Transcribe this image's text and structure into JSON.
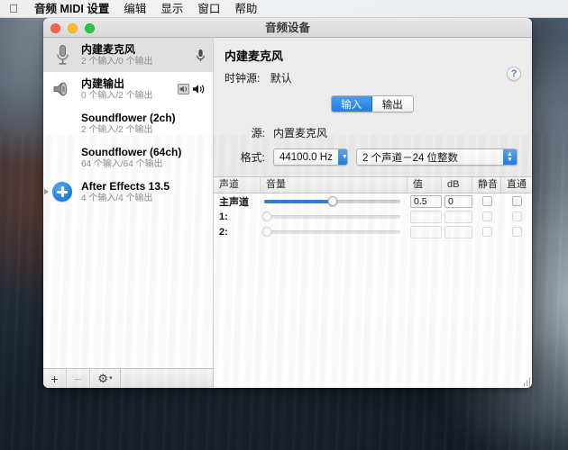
{
  "menubar": {
    "apple_icon": "apple-icon",
    "items": [
      {
        "label": "音频 MIDI 设置",
        "bold": true
      },
      {
        "label": "编辑",
        "bold": false
      },
      {
        "label": "显示",
        "bold": false
      },
      {
        "label": "窗口",
        "bold": false
      },
      {
        "label": "帮助",
        "bold": false
      }
    ]
  },
  "window": {
    "title": "音频设备",
    "traffic_lights": [
      "close",
      "minimize",
      "zoom"
    ]
  },
  "sidebar": {
    "devices": [
      {
        "name": "内建麦克风",
        "sub": "2 个输入/0 个输出",
        "icon": "microphone-icon",
        "selected": true,
        "badges": [
          "mic-input-badge"
        ]
      },
      {
        "name": "内建输出",
        "sub": "0 个输入/2 个输出",
        "icon": "speaker-icon",
        "selected": false,
        "badges": [
          "sound-output-badge",
          "speaker-badge"
        ]
      },
      {
        "name": "Soundflower (2ch)",
        "sub": "2 个输入/2 个输出",
        "icon": "none",
        "selected": false,
        "badges": []
      },
      {
        "name": "Soundflower (64ch)",
        "sub": "64 个输入/64 个输出",
        "icon": "none",
        "selected": false,
        "badges": []
      },
      {
        "name": "After Effects 13.5",
        "sub": "4 个输入/4 个输出",
        "icon": "plus-circle-icon",
        "selected": false,
        "badges": [],
        "disclosure": true
      }
    ],
    "toolbar": {
      "add_label": "+",
      "remove_label": "−",
      "gear_label": "⚙",
      "gear_chevron": "▾"
    }
  },
  "pane": {
    "device_title": "内建麦克风",
    "clock_label": "时钟源:",
    "clock_value": "默认",
    "help_label": "?",
    "tabs": [
      {
        "label": "输入",
        "active": true
      },
      {
        "label": "输出",
        "active": false
      }
    ],
    "source_label": "源:",
    "source_value": "内置麦克风",
    "format_label": "格式:",
    "sample_rate": "44100.0 Hz",
    "bit_format": "2 个声道－24 位整数"
  },
  "table": {
    "headers": {
      "channel": "声道",
      "volume": "音量",
      "value": "值",
      "db": "dB",
      "mute": "静音",
      "thru": "直通"
    },
    "rows": [
      {
        "channel": "主声道",
        "slider": 50,
        "value": "0.5",
        "db": "0",
        "mute": false,
        "thru": false,
        "enabled": true
      },
      {
        "channel": "1:",
        "slider": 0,
        "value": "",
        "db": "",
        "mute": false,
        "thru": false,
        "enabled": false
      },
      {
        "channel": "2:",
        "slider": 0,
        "value": "",
        "db": "",
        "mute": false,
        "thru": false,
        "enabled": false
      }
    ]
  },
  "colors": {
    "accent_blue": "#2b7fe0",
    "tab_active": "#1f7fe4",
    "help_blue": "#3b7fd4",
    "selected_row": "#e0e0e0"
  }
}
